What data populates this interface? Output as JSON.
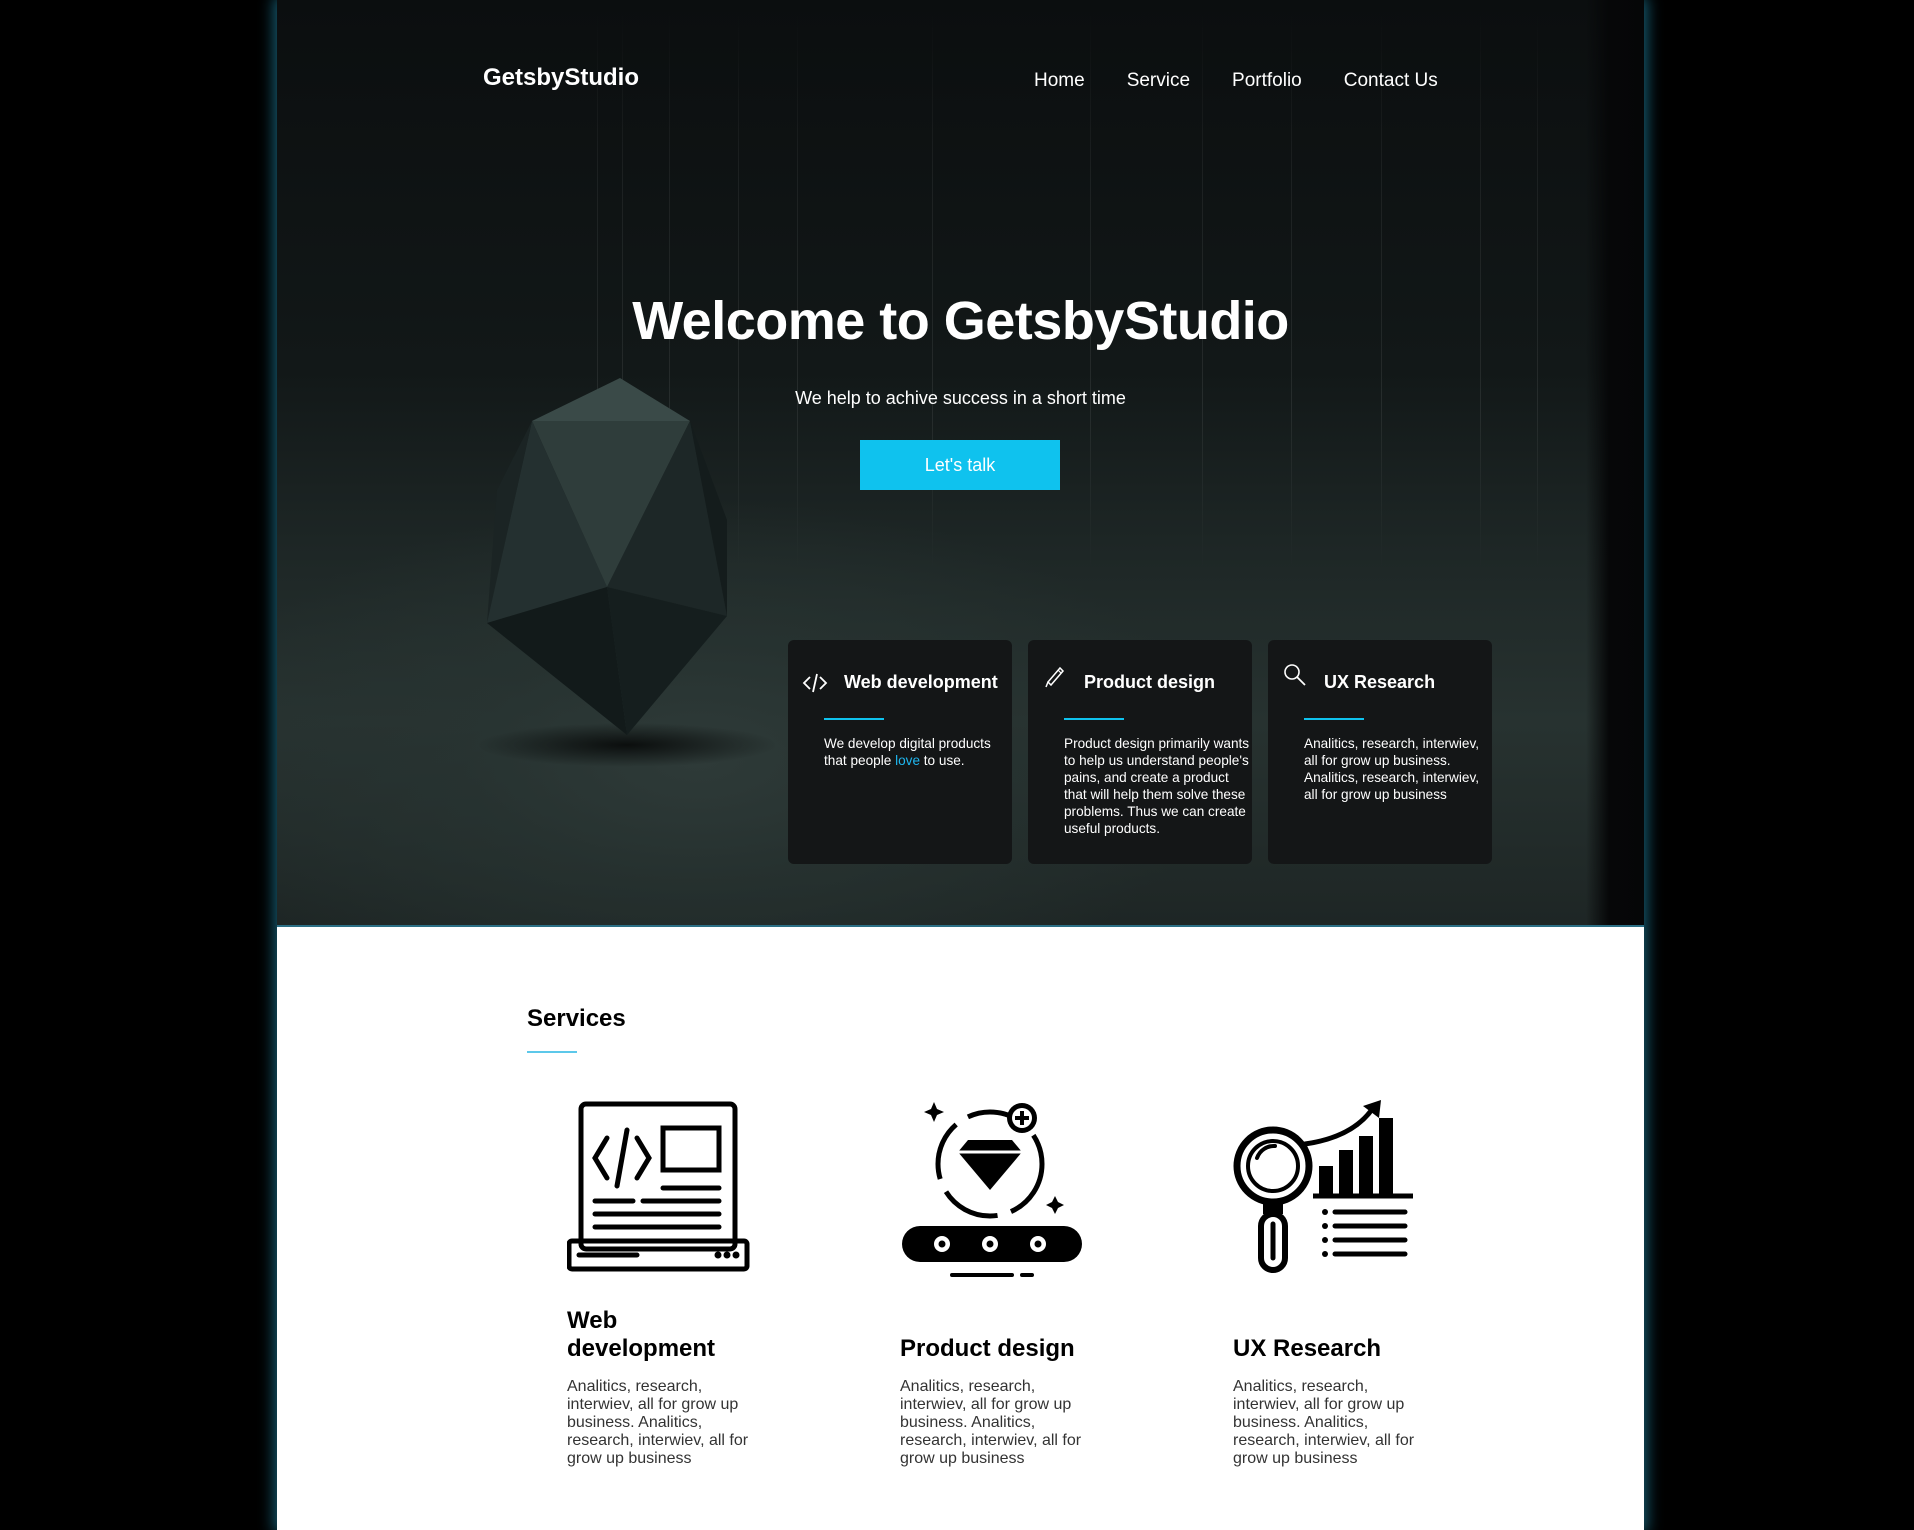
{
  "brand": {
    "name": "GetsbyStudio"
  },
  "nav": {
    "items": [
      {
        "label": "Home"
      },
      {
        "label": "Service"
      },
      {
        "label": "Portfolio"
      },
      {
        "label": "Contact Us"
      }
    ]
  },
  "hero": {
    "title_prefix": "Welcome to ",
    "title_brand": "GetsbyStudio",
    "subtitle": "We help to achive success in a short time",
    "cta_label": "Let's talk"
  },
  "feature_cards": [
    {
      "icon": "code-icon",
      "title": "Web development",
      "text_before": "We develop digital products that people ",
      "text_highlight": "love",
      "text_after": " to use."
    },
    {
      "icon": "pencil-icon",
      "title": "Product design",
      "text": "Product design primarily wants to help us understand people's pains, and create a product that will help them solve these problems. Thus we can create useful products."
    },
    {
      "icon": "search-icon",
      "title": "UX Research",
      "text": "Analitics, research, interwiev, all for grow up business. Analitics, research, interwiev, all for grow up business"
    }
  ],
  "services": {
    "title": "Services",
    "items": [
      {
        "icon": "web-development-icon",
        "title": "Web development",
        "text": "Analitics, research, interwiev, all for grow up business. Analitics, research, interwiev, all for grow up business"
      },
      {
        "icon": "product-design-icon",
        "title": "Product design",
        "text": "Analitics, research, interwiev, all for grow up business. Analitics, research, interwiev, all for grow up business"
      },
      {
        "icon": "ux-research-icon",
        "title": "UX Research",
        "text": "Analitics, research, interwiev, all for grow up business. Analitics, research, interwiev, all for grow up business"
      }
    ]
  },
  "colors": {
    "accent": "#0fc2ee",
    "card_bg": "#141617",
    "hero_bg": "#121818"
  }
}
